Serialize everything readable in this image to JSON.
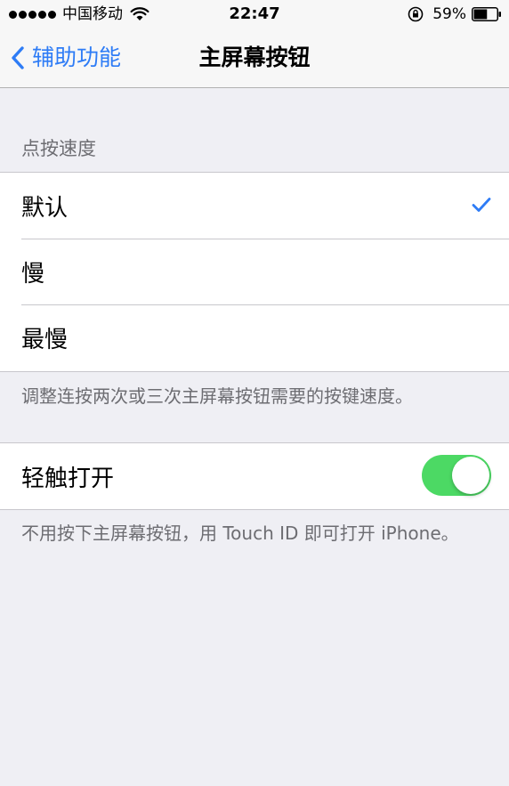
{
  "status_bar": {
    "carrier": "中国移动",
    "time": "22:47",
    "battery_percent": "59%",
    "battery_level": 0.59,
    "signal_icon": "signal-dots-icon",
    "wifi_icon": "wifi-icon",
    "lock_icon": "rotation-lock-icon",
    "battery_icon": "battery-icon"
  },
  "nav": {
    "back_label": "辅助功能",
    "title": "主屏幕按钮",
    "accent_color": "#2e7cf6"
  },
  "speed_section": {
    "header": "点按速度",
    "options": [
      {
        "label": "默认",
        "selected": true
      },
      {
        "label": "慢",
        "selected": false
      },
      {
        "label": "最慢",
        "selected": false
      }
    ],
    "footer": "调整连按两次或三次主屏幕按钮需要的按键速度。"
  },
  "rest_finger": {
    "label": "轻触打开",
    "enabled": true,
    "toggle_color": "#4cd964",
    "footer": "不用按下主屏幕按钮，用 Touch ID 即可打开 iPhone。"
  }
}
